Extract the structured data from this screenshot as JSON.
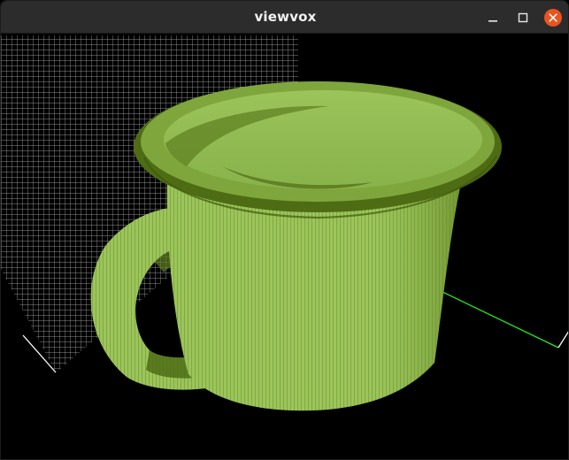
{
  "window": {
    "title": "viewvox"
  },
  "controls": {
    "minimize_icon": "minimize-icon",
    "maximize_icon": "maximize-icon",
    "close_icon": "close-icon",
    "close_color": "#e95420"
  },
  "scene": {
    "background": "#000000",
    "object": "mug",
    "voxel_light_color": "#9bc55b",
    "voxel_dark_color": "#4e6c14",
    "grid_color": "#b8b8b8",
    "axis_x_color": "#ffffff",
    "axis_y_color": "#22ee22"
  }
}
